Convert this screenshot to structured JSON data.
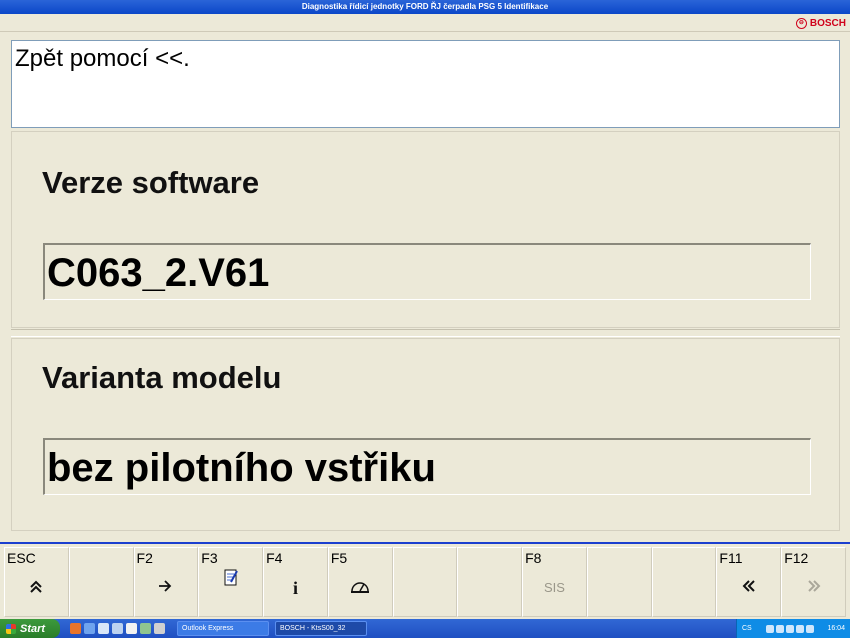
{
  "window": {
    "title": "Diagnostika řídicí jednotky  FORD  ŘJ čerpadla PSG 5  Identifikace"
  },
  "brand": {
    "name": "BOSCH"
  },
  "help": {
    "text": "Zpět pomocí <<."
  },
  "fields": [
    {
      "label": "Verze software",
      "value": "C063_2.V61"
    },
    {
      "label": "Varianta modelu",
      "value": "bez pilotního vstřiku"
    }
  ],
  "fkeys": [
    {
      "key": "ESC",
      "icon": "double-up-chevron-icon",
      "glyph": "⌃",
      "enabled": true
    },
    {
      "key": "",
      "glyph": "",
      "enabled": false
    },
    {
      "key": "F2",
      "icon": "enter-arrow-icon",
      "glyph": "⇨",
      "enabled": true
    },
    {
      "key": "F3",
      "icon": "notepad-icon",
      "glyph": "📝",
      "enabled": true
    },
    {
      "key": "F4",
      "icon": "info-icon",
      "glyph": "ℹ",
      "enabled": true
    },
    {
      "key": "F5",
      "icon": "gauge-icon",
      "glyph": "◒",
      "enabled": true
    },
    {
      "key": "",
      "glyph": "",
      "enabled": false
    },
    {
      "key": "",
      "glyph": "",
      "enabled": false
    },
    {
      "key": "F8",
      "text": "SIS",
      "enabled": false
    },
    {
      "key": "",
      "glyph": "",
      "enabled": false
    },
    {
      "key": "",
      "glyph": "",
      "enabled": false
    },
    {
      "key": "F11",
      "icon": "double-left-chevron-icon",
      "glyph": "«",
      "enabled": true
    },
    {
      "key": "F12",
      "icon": "double-right-chevron-icon",
      "glyph": "»",
      "enabled": false
    }
  ],
  "taskbar": {
    "start_label": "Start",
    "tasks": [
      "Outlook Express",
      "BOSCH - KtsS00_32"
    ],
    "tray": {
      "lang": "CS",
      "time": "16:04"
    }
  }
}
